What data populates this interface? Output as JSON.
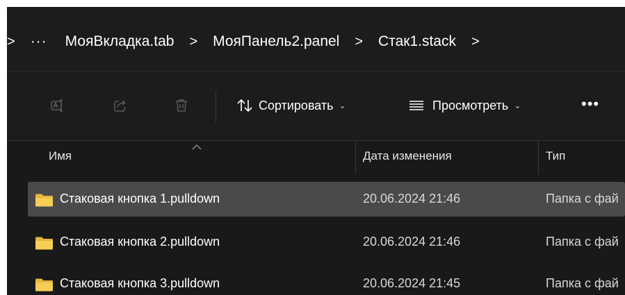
{
  "breadcrumb": {
    "ellipsis": "···",
    "items": [
      "МояВкладка.tab",
      "МояПанель2.panel",
      "Стак1.stack"
    ],
    "separator": ">"
  },
  "toolbar": {
    "rename_icon": "rename-icon",
    "share_icon": "share-icon",
    "delete_icon": "trash-icon",
    "sort_label": "Сортировать",
    "view_label": "Просмотреть",
    "more_label": "•••",
    "chevron": "⌄"
  },
  "columns": {
    "name": "Имя",
    "date": "Дата изменения",
    "type": "Тип"
  },
  "files": [
    {
      "name": "Стаковая кнопка 1.pulldown",
      "date": "20.06.2024 21:46",
      "type": "Папка с фай",
      "selected": true
    },
    {
      "name": "Стаковая кнопка 2.pulldown",
      "date": "20.06.2024 21:46",
      "type": "Папка с фай",
      "selected": false
    },
    {
      "name": "Стаковая кнопка 3.pulldown",
      "date": "20.06.2024 21:45",
      "type": "Папка с фай",
      "selected": false
    }
  ],
  "colors": {
    "background": "#191919",
    "selected_row": "#4a4a4a",
    "folder": "#f0c24b"
  }
}
